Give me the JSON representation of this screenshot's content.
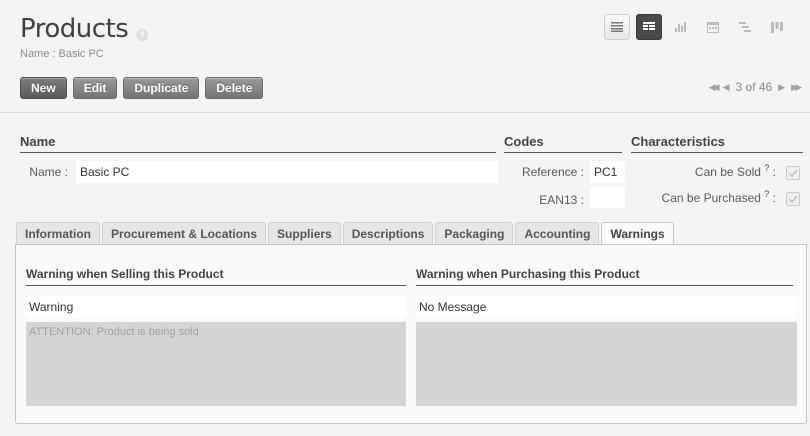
{
  "header": {
    "title": "Products",
    "help": "?",
    "subtitle": "Name : Basic PC"
  },
  "view_switch": [
    "list-view-icon",
    "form-view-icon",
    "graph-view-icon",
    "calendar-view-icon",
    "gantt-view-icon",
    "kanban-view-icon"
  ],
  "toolbar": {
    "new_label": "New",
    "edit_label": "Edit",
    "duplicate_label": "Duplicate",
    "delete_label": "Delete"
  },
  "pager": {
    "first": "◀◀",
    "prev": "◀",
    "status": "3 of 46",
    "next": "▶",
    "last": "▶▶"
  },
  "groups": {
    "name": "Name",
    "codes": "Codes",
    "characteristics": "Characteristics"
  },
  "fields": {
    "name_label": "Name :",
    "name_value": "Basic PC",
    "reference_label": "Reference :",
    "reference_value": "PC1",
    "ean13_label": "EAN13 :",
    "ean13_value": "",
    "can_be_sold_label": "Can be Sold",
    "can_be_purchased_label": "Can be Purchased",
    "help_q": "?",
    "colon": ":"
  },
  "tabs": [
    "Information",
    "Procurement & Locations",
    "Suppliers",
    "Descriptions",
    "Packaging",
    "Accounting",
    "Warnings"
  ],
  "active_tab": "Warnings",
  "warnings": {
    "selling_title": "Warning when Selling this Product",
    "selling_value": "Warning",
    "selling_message": "ATTENTION: Product is being sold",
    "purchasing_title": "Warning when Purchasing this Product",
    "purchasing_value": "No Message",
    "purchasing_message": ""
  }
}
